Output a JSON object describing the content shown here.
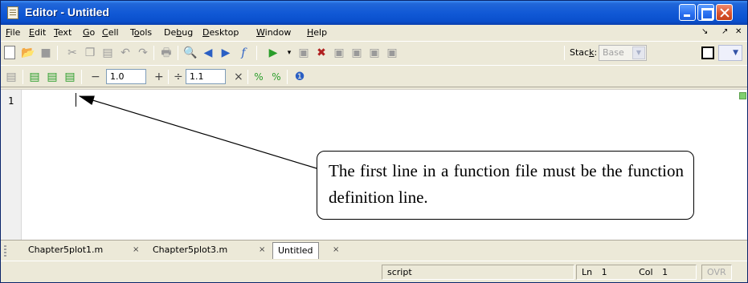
{
  "window": {
    "title": "Editor - Untitled"
  },
  "menu": {
    "items": [
      {
        "key": "F",
        "rest": "ile"
      },
      {
        "key": "E",
        "rest": "dit"
      },
      {
        "key": "T",
        "rest": "ext"
      },
      {
        "key": "G",
        "rest": "o"
      },
      {
        "key": "C",
        "rest": "ell"
      },
      {
        "pre": "T",
        "key": "o",
        "rest": "ols"
      },
      {
        "pre": "De",
        "key": "b",
        "rest": "ug"
      },
      {
        "key": "D",
        "rest": "esktop"
      },
      {
        "key": "W",
        "rest": "indow"
      },
      {
        "key": "H",
        "rest": "elp"
      }
    ],
    "right_undock": "↘",
    "right_dock": "↗",
    "right_close": "✕"
  },
  "toolbar1": {
    "stack_label_key": "k",
    "stack_label_pre": "Stac",
    "stack_label_post": ":",
    "stack_value": "Base"
  },
  "toolbar2": {
    "minus": "−",
    "decrease_value": "1.0",
    "plus": "+",
    "divide": "÷",
    "increase_value": "1.1",
    "times": "×"
  },
  "editor": {
    "line_number": "1",
    "callout_text": "The first line in a function file must be the function definition line."
  },
  "tabs": [
    {
      "label": "Chapter5plot1.m",
      "active": false
    },
    {
      "label": "Chapter5plot3.m",
      "active": false
    },
    {
      "label": "Untitled",
      "active": true
    }
  ],
  "tab_close": "×",
  "status": {
    "mode": "script",
    "ln_label": "Ln",
    "ln_value": "1",
    "col_label": "Col",
    "col_value": "1",
    "ovr": "OVR"
  },
  "colors": {
    "titlebar": "#0a4fcc",
    "chrome": "#ece9d8",
    "close_button": "#d9542e"
  }
}
